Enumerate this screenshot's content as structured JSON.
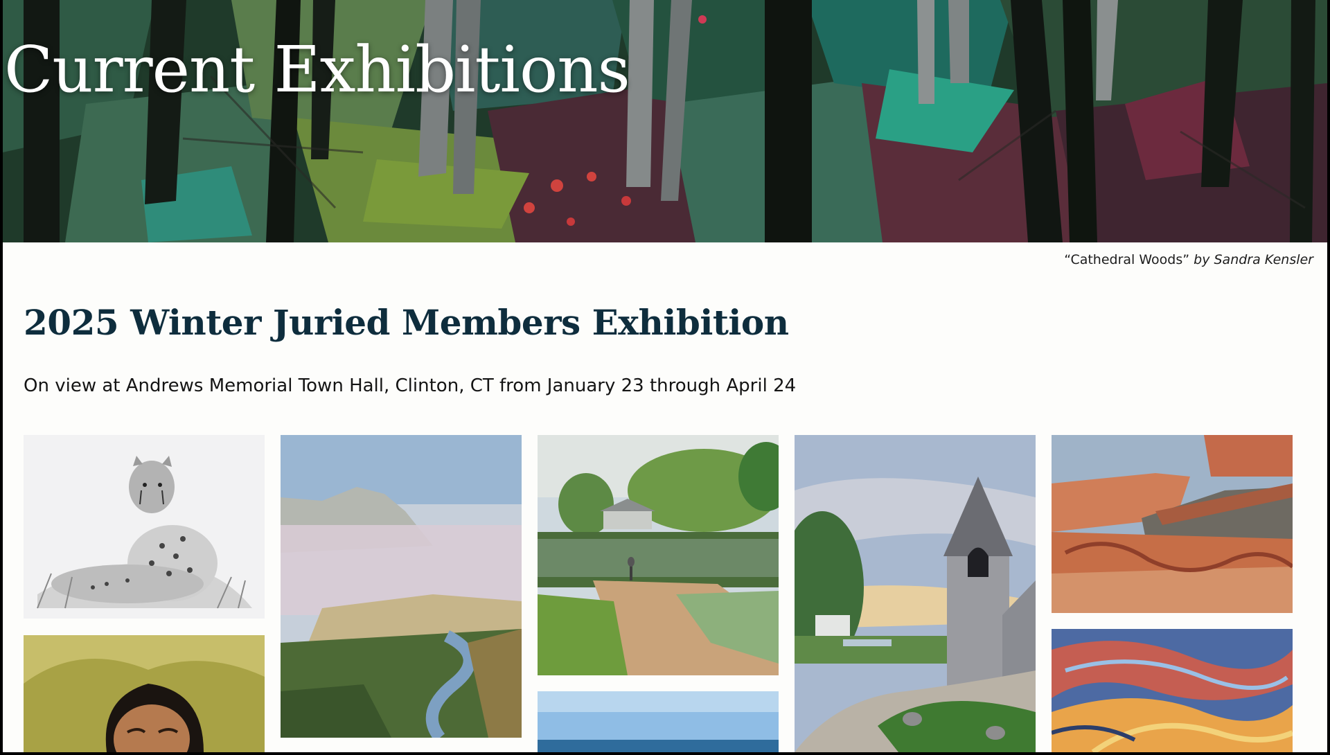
{
  "hero": {
    "title": "Current Exhibitions",
    "caption_title": "“Cathedral Woods”",
    "caption_by": "by Sandra Kensler"
  },
  "exhibition": {
    "title": "2025 Winter Juried Members Exhibition",
    "subtitle": "On view at Andrews Memorial Town Hall, Clinton, CT from January 23 through April 24"
  },
  "gallery": {
    "artworks": [
      {
        "subject": "cheetah pencil drawing"
      },
      {
        "subject": "woman portrait painting"
      },
      {
        "subject": "mountain valley river landscape"
      },
      {
        "subject": "covered bridge pond with heron"
      },
      {
        "subject": "seascape horizon"
      },
      {
        "subject": "church steeple by road"
      },
      {
        "subject": "red rock mesa"
      },
      {
        "subject": "abstract swirling sunset"
      }
    ]
  }
}
